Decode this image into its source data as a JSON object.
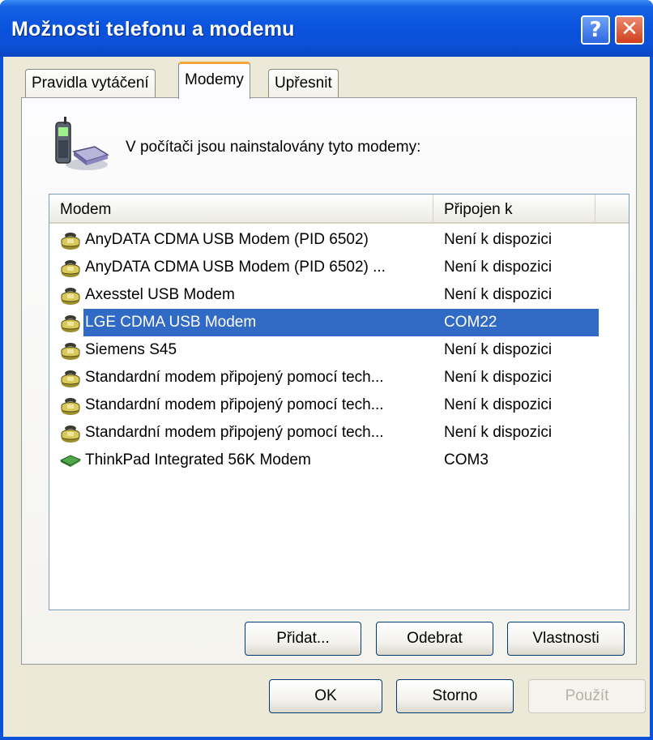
{
  "window": {
    "title": "Možnosti telefonu a modemu"
  },
  "titlebar_buttons": {
    "help": "?",
    "close": "✕"
  },
  "tabs": [
    {
      "label": "Pravidla vytáčení",
      "active": false
    },
    {
      "label": "Modemy",
      "active": true
    },
    {
      "label": "Upřesnit",
      "active": false
    }
  ],
  "panel": {
    "intro": "V počítači jsou nainstalovány tyto modemy:"
  },
  "list": {
    "columns": [
      "Modem",
      "Připojen k"
    ],
    "rows": [
      {
        "name": "AnyDATA CDMA USB Modem (PID 6502)",
        "port": "Není k dispozici",
        "icon": "modem-phone-icon",
        "selected": false
      },
      {
        "name": "AnyDATA CDMA USB Modem (PID 6502) ...",
        "port": "Není k dispozici",
        "icon": "modem-phone-icon",
        "selected": false
      },
      {
        "name": "Axesstel USB Modem",
        "port": "Není k dispozici",
        "icon": "modem-phone-icon",
        "selected": false
      },
      {
        "name": "LGE CDMA USB Modem",
        "port": "COM22",
        "icon": "modem-phone-icon",
        "selected": true
      },
      {
        "name": "Siemens S45",
        "port": "Není k dispozici",
        "icon": "modem-phone-icon",
        "selected": false
      },
      {
        "name": "Standardní modem připojený pomocí tech...",
        "port": "Není k dispozici",
        "icon": "modem-phone-icon",
        "selected": false
      },
      {
        "name": "Standardní modem připojený pomocí tech...",
        "port": "Není k dispozici",
        "icon": "modem-phone-icon",
        "selected": false
      },
      {
        "name": "Standardní modem připojený pomocí tech...",
        "port": "Není k dispozici",
        "icon": "modem-phone-icon",
        "selected": false
      },
      {
        "name": "ThinkPad Integrated 56K Modem",
        "port": "COM3",
        "icon": "modem-card-icon",
        "selected": false
      }
    ]
  },
  "buttons": {
    "add": "Přidat...",
    "remove": "Odebrat",
    "properties": "Vlastnosti",
    "ok": "OK",
    "cancel": "Storno",
    "apply": "Použít"
  },
  "colors": {
    "title_bar": "#0a54df",
    "selection": "#316ac5",
    "tab_accent": "#f2a43a"
  }
}
